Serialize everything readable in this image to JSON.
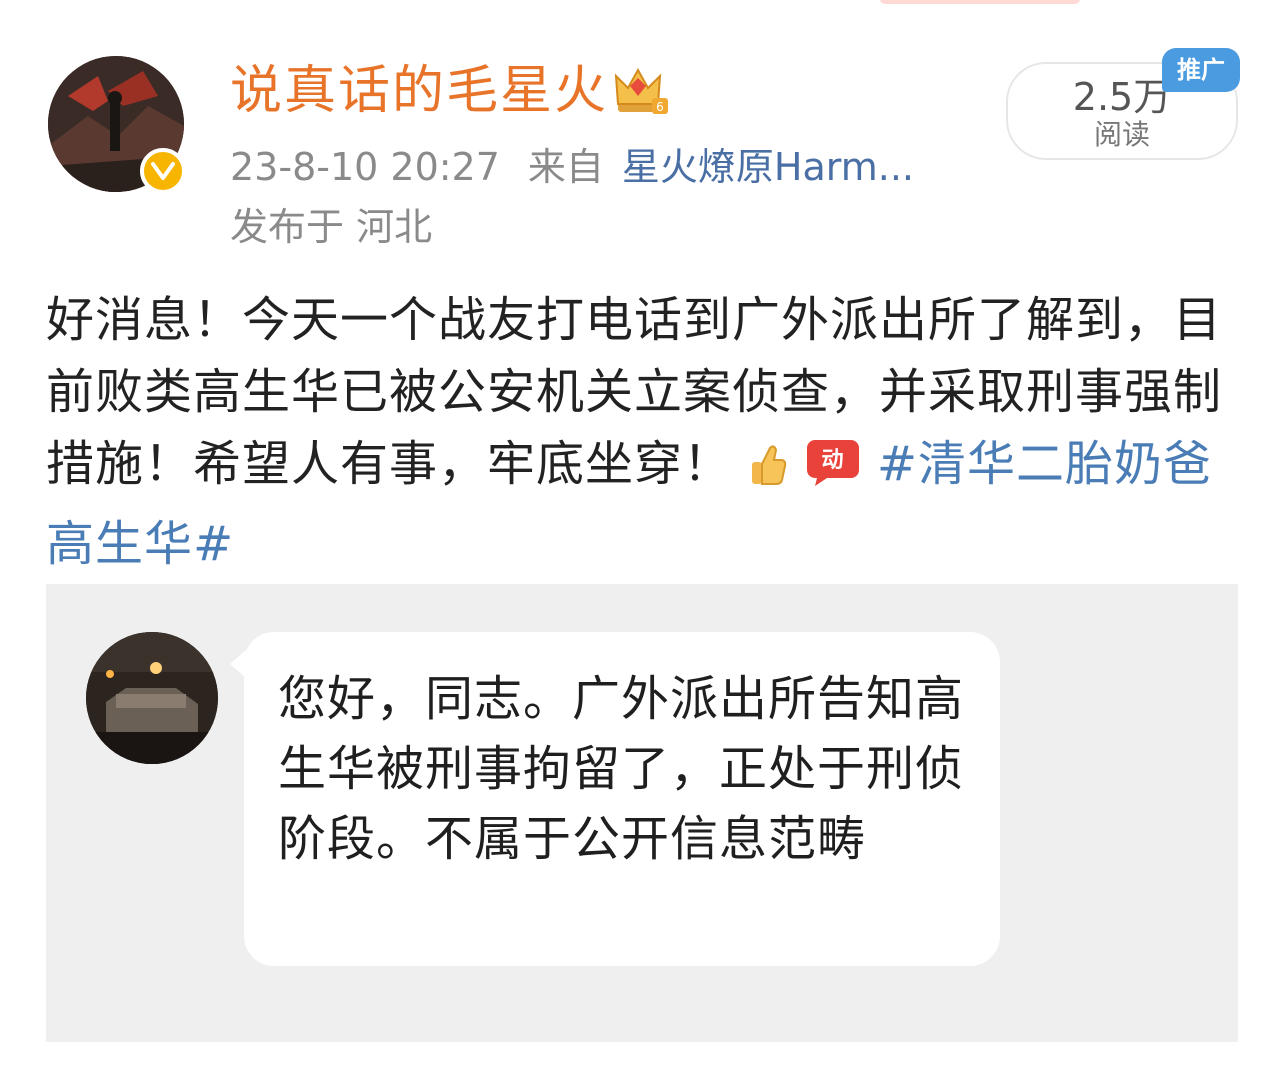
{
  "author": {
    "name": "说真话的毛星火",
    "level_icon": "crown-icon",
    "verified_icon": "verified-v-icon"
  },
  "post": {
    "meta": {
      "date": "23-8-10 20:27",
      "source_prefix": "来自",
      "source_name": "星火燎原Harm...",
      "location": "发布于 河北"
    },
    "read_count": "2.5万",
    "read_label": "阅读",
    "promo_label": "推广",
    "body_text": "好消息！今天一个战友打电话到广外派出所了解到，目前败类高生华已被公安机关立案侦查，并采取刑事强制措施！希望人有事，牢底坐穿！",
    "emoji": [
      "thumbs-up-icon",
      "excited-emoji-icon"
    ],
    "hashtag": "#清华二胎奶爸高生华#"
  },
  "quoted_message": {
    "text": "您好，同志。广外派出所告知高生华被刑事拘留了，正处于刑侦阶段。不属于公开信息范畴"
  },
  "colors": {
    "author_name": "#e8742a",
    "link": "#4a7cb5",
    "meta_gray": "#8a8a8a",
    "promo_blue": "#4b9be0",
    "quote_bg": "#efefef"
  }
}
